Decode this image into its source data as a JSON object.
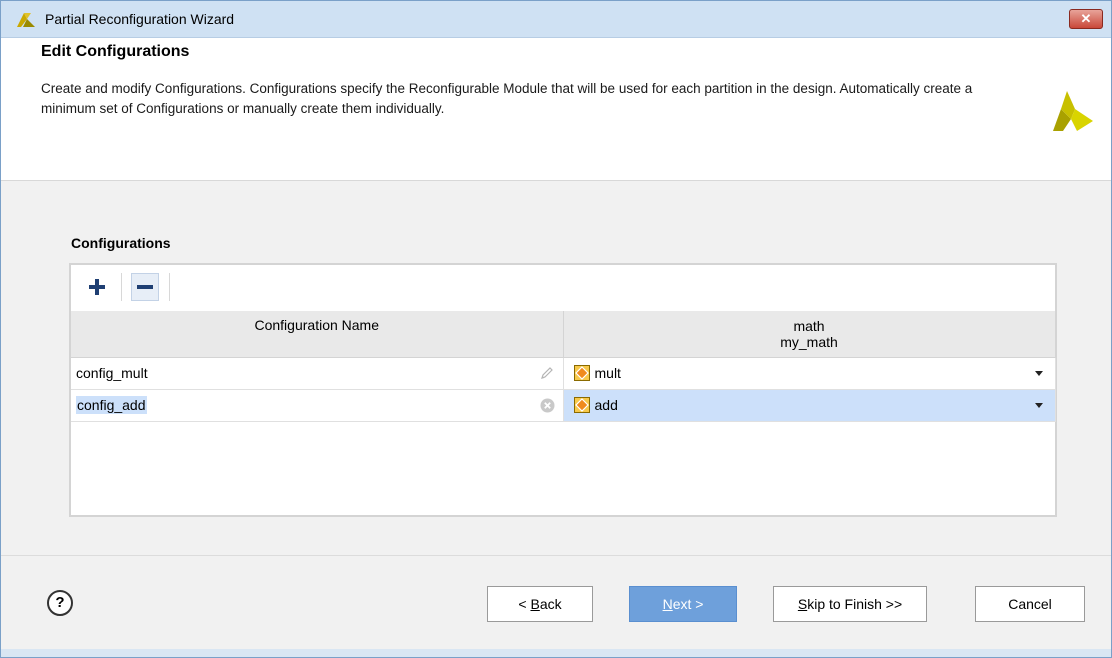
{
  "window": {
    "title": "Partial Reconfiguration Wizard",
    "close_icon": "close-icon"
  },
  "header": {
    "title": "Edit Configurations",
    "description": "Create and modify Configurations. Configurations specify the Reconfigurable Module that will be used for each partition in the design. Automatically create a minimum set of Configurations or manually create them individually."
  },
  "configurations": {
    "label": "Configurations",
    "toolbar": {
      "add_icon": "plus-icon",
      "remove_icon": "minus-icon"
    },
    "columns": {
      "name": "Configuration Name",
      "partition_line1": "math",
      "partition_line2": "my_math"
    },
    "rows": [
      {
        "name": "config_mult",
        "module": "mult",
        "selected": false
      },
      {
        "name": "config_add",
        "module": "add",
        "selected": true
      }
    ]
  },
  "footer": {
    "help": "?",
    "back": {
      "prefix": "< ",
      "mnemonic": "B",
      "rest": "ack"
    },
    "next": {
      "mnemonic": "N",
      "rest": "ext >"
    },
    "skip": {
      "mnemonic": "S",
      "rest": "kip to Finish >>"
    },
    "cancel": "Cancel"
  },
  "colors": {
    "accent": "#6ea0db",
    "selection": "#cce0fa",
    "logo": "#c8c000"
  }
}
